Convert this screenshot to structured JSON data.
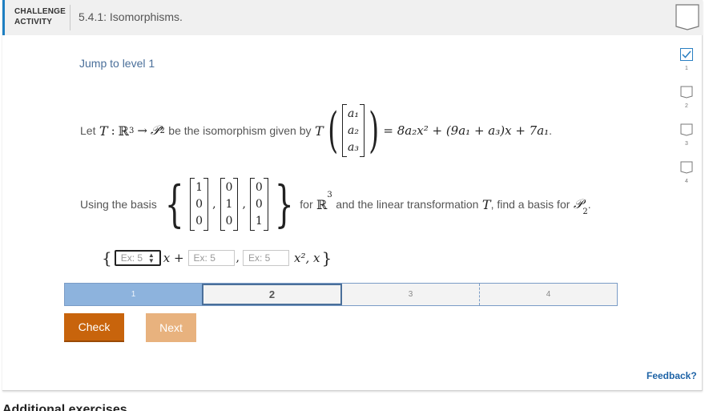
{
  "header": {
    "label_line1": "CHALLENGE",
    "label_line2": "ACTIVITY",
    "title": "5.4.1: Isomorphisms."
  },
  "jump_link": "Jump to level 1",
  "problem": {
    "let": "Let",
    "T": "T",
    "colon": ":",
    "R": "ℝ",
    "R_exp": "3",
    "arrow": "→",
    "P": "𝒫",
    "P_sub": "2",
    "be_iso": "be the isomorphism given by",
    "vec_entries": [
      "a₁",
      "a₂",
      "a₃"
    ],
    "rhs": "= 8a₂x² + (9a₁ + a₃)x + 7a₁",
    "period": ".",
    "using_basis": "Using the basis",
    "basis_vectors": [
      [
        "1",
        "0",
        "0"
      ],
      [
        "0",
        "1",
        "0"
      ],
      [
        "0",
        "0",
        "1"
      ]
    ],
    "comma": ",",
    "for_text": "for",
    "and_text": "and the linear transformation",
    "find_text": ", find a basis for",
    "answer": {
      "open_brace": "{",
      "input1_placeholder": "Ex: 5",
      "x_plus": "x +",
      "input2_placeholder": "Ex: 5",
      "comma": ",",
      "input3_placeholder": "Ex: 5",
      "x2_x": "x², x",
      "close_brace": "}"
    }
  },
  "levels": [
    {
      "label": "1",
      "state": "done"
    },
    {
      "label": "2",
      "state": "current"
    },
    {
      "label": "3",
      "state": "todo"
    },
    {
      "label": "4",
      "state": "todo"
    }
  ],
  "buttons": {
    "check": "Check",
    "next": "Next"
  },
  "feedback": "Feedback?",
  "side_levels": [
    "1",
    "2",
    "3",
    "4"
  ],
  "footer": "Additional exercises",
  "colors": {
    "accent_blue": "#1e7fc2",
    "check_orange": "#c8640c",
    "next_disabled": "#e8b27e",
    "level_done": "#8db3dd"
  }
}
